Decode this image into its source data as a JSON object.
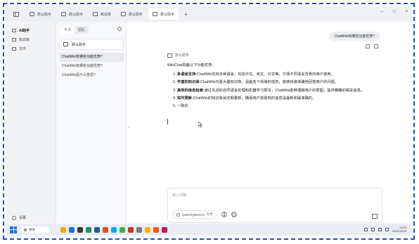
{
  "tabs": [
    {
      "label": "默认助手",
      "active": false
    },
    {
      "label": "默认助手",
      "active": false
    },
    {
      "label": "知识库",
      "active": false
    },
    {
      "label": "默认助手",
      "active": false
    },
    {
      "label": "默认助手",
      "active": true
    }
  ],
  "tab_new": "+",
  "window_controls": {
    "minimize": "–",
    "maximize": "□",
    "close": "×"
  },
  "sidebar": {
    "items": [
      {
        "label": "AI助手",
        "icon": "chat-icon",
        "active": true
      },
      {
        "label": "知识库",
        "icon": "book-icon",
        "active": false
      },
      {
        "label": "文件",
        "icon": "file-icon",
        "active": false
      }
    ],
    "settings_label": "设置"
  },
  "list_panel": {
    "segments": [
      "个人",
      "团队"
    ],
    "assistant_name": "默认助手",
    "topics": [
      "ChatWiki有哪些功能优势?",
      "ChatWiki有哪些功能优势?",
      "ChatWiki是什么意思?"
    ]
  },
  "chat": {
    "user_message": "ChatWiki有哪些功能优势?",
    "bot_name": "默认助手",
    "answer_intro": "WikiChat具备以下功能优势:",
    "answer_items": [
      {
        "num": "1.",
        "title": "多语言支持",
        "text": ":ChatWiki支持多种语言，包括中文、英文、日文等，方便不同语言背景的用户使用。"
      },
      {
        "num": "2.",
        "title": "丰富的知识库",
        "text": ":ChatWiki内置大量知识库，涵盖各个领域的信息，能够快速准确地回答用户的问题。"
      },
      {
        "num": "3.",
        "title": "高效的信息检索",
        "text": ":通过先进的自然语言处理和机器学习算法，ChatWiki能够理解用户的意图，提供精确的相关信息。"
      },
      {
        "num": "4.",
        "title": "实时更新",
        "text": ":ChatWiki的知识库会定期更新，确保用户获取到的信息是最新和最准确的。"
      },
      {
        "num": "5.",
        "title": "",
        "text": "一致的"
      }
    ],
    "input_placeholder": "输入问题",
    "model_label": "Qwen/Qwen2.5",
    "model_suffix": "免费",
    "attach_icon": "paperclip-icon"
  },
  "taskbar": {
    "search_label": "搜索",
    "app_colors": [
      "#f2a900",
      "#1f6feb",
      "#3a3a3a",
      "#0f9d58",
      "#2b5797",
      "#e34c26",
      "#18a0fb",
      "#3cb043",
      "#d93025",
      "#7a7a7a",
      "#ffb300",
      "#f4511e",
      "#c2185b"
    ],
    "clock_time": "11:53",
    "clock_date": "2024/12/18"
  }
}
